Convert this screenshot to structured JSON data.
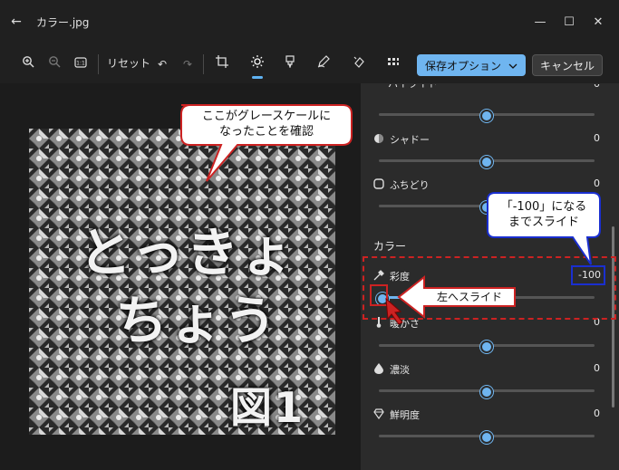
{
  "window": {
    "title": "カラー.jpg",
    "back_icon": "arrow-left-icon",
    "minimize": "—",
    "maximize": "☐",
    "close": "✕"
  },
  "toolbar": {
    "reset_label": "リセット",
    "save_label": "保存オプション",
    "cancel_label": "キャンセル"
  },
  "photo": {
    "line1": "とっきょ",
    "line2": "ちょう",
    "figure_label": "図1"
  },
  "panel": {
    "highlight_label": "ハイライト",
    "highlight_value": "0",
    "shadow_label": "シャドー",
    "shadow_value": "0",
    "vignette_label": "ふちどり",
    "vignette_value": "0",
    "color_section": "カラー",
    "saturation_label": "彩度",
    "saturation_value": "-100",
    "warmth_label": "暖かさ",
    "warmth_value": "0",
    "tint_label": "濃淡",
    "tint_value": "0",
    "vividness_label": "鮮明度",
    "vividness_value": "0"
  },
  "sliders": {
    "highlight": 0.5,
    "shadow": 0.5,
    "vignette": 0.5,
    "saturation": 0.0,
    "warmth": 0.5,
    "tint": 0.5,
    "vividness": 0.5
  },
  "annotations": {
    "grayscale_callout_line1": "ここがグレースケールに",
    "grayscale_callout_line2": "なったことを確認",
    "value_callout_line1": "「-100」になる",
    "value_callout_line2": "までスライド",
    "arrow_label": "左へスライド"
  },
  "colors": {
    "accent": "#6fb5f0",
    "annotation_red": "#cc2222",
    "annotation_blue": "#1a2fd0"
  }
}
